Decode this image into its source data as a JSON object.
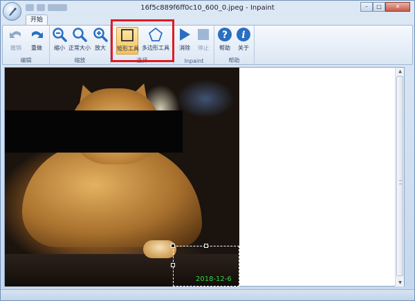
{
  "window": {
    "title": "16f5c889f6ff0c10_600_0.jpeg - Inpaint",
    "minimize": "–",
    "maximize": "□",
    "close": "✕"
  },
  "ribbon": {
    "tab_label": "开始",
    "groups": {
      "edit": {
        "label": "编辑",
        "undo": "撤销",
        "redo": "重做"
      },
      "zoom": {
        "label": "缩放",
        "zoom_out": "缩小",
        "actual_size": "正常大小",
        "zoom_in": "放大"
      },
      "select": {
        "label": "选择",
        "rect_tool": "矩形工具",
        "polygon_tool": "多边形工具"
      },
      "inpaint": {
        "label": "Inpaint",
        "erase": "消除",
        "stop": "停止"
      },
      "help": {
        "label": "帮助",
        "help": "帮助",
        "about": "关于"
      }
    }
  },
  "image": {
    "date_stamp": "2018-12-6"
  },
  "colors": {
    "highlight": "#e0191e",
    "date_stamp": "#33d64a",
    "icon_blue": "#2a6fc2"
  }
}
